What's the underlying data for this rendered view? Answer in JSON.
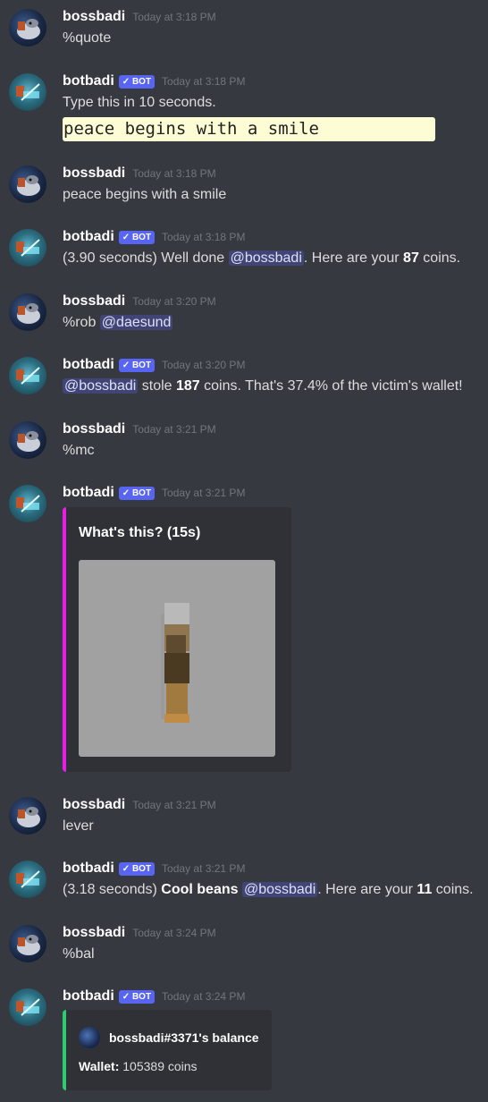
{
  "colors": {
    "background": "#36393f",
    "bot_badge": "#5865f2",
    "mention_bg": "#414675",
    "embed_bg": "#2f3136",
    "mc_embed_bar": "#e91ee6",
    "balance_embed_bar": "#2ecc71",
    "code_bg": "#fdfdd5"
  },
  "users": {
    "user": "bossbadi",
    "bot": "botbadi",
    "bot_badge": "BOT"
  },
  "messages": [
    {
      "author": "bossbadi",
      "time": "Today at 3:18 PM",
      "text": "%quote"
    },
    {
      "author": "botbadi",
      "time": "Today at 3:18 PM",
      "text": "Type this in 10 seconds.",
      "code": "peace begins with a smile"
    },
    {
      "author": "bossbadi",
      "time": "Today at 3:18 PM",
      "text": "peace begins with a smile"
    },
    {
      "author": "botbadi",
      "time": "Today at 3:18 PM",
      "pre": "(3.90 seconds) Well done ",
      "mention": "@bossbadi",
      "mid": ". Here are your ",
      "bold": "87",
      "post": " coins."
    },
    {
      "author": "bossbadi",
      "time": "Today at 3:20 PM",
      "pre": "%rob ",
      "mention": "@daesund"
    },
    {
      "author": "botbadi",
      "time": "Today at 3:20 PM",
      "mention": "@bossbadi",
      "mid": " stole ",
      "bold": "187",
      "post": " coins. That's 37.4% of the victim's wallet!"
    },
    {
      "author": "bossbadi",
      "time": "Today at 3:21 PM",
      "text": "%mc"
    },
    {
      "author": "botbadi",
      "time": "Today at 3:21 PM",
      "embed_title": "What's this? (15s)",
      "image_icon": "minecraft-lever-icon"
    },
    {
      "author": "bossbadi",
      "time": "Today at 3:21 PM",
      "text": "lever"
    },
    {
      "author": "botbadi",
      "time": "Today at 3:21 PM",
      "pre": "(3.18 seconds) ",
      "bold_phrase": "Cool beans",
      "mention": "@bossbadi",
      "mid": ". Here are your ",
      "bold": "11",
      "post": " coins."
    },
    {
      "author": "bossbadi",
      "time": "Today at 3:24 PM",
      "text": "%bal"
    },
    {
      "author": "botbadi",
      "time": "Today at 3:24 PM",
      "embed_author": "bossbadi#3371's balance",
      "field_name": "Wallet:",
      "field_value": " 105389 coins"
    }
  ]
}
